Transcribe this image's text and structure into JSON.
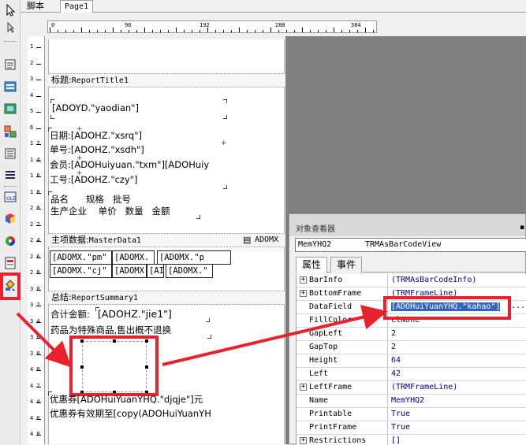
{
  "tabs": [
    {
      "label": "脚本"
    },
    {
      "label": "Page1"
    }
  ],
  "ruler": {
    "top_labels": [
      "0",
      "96",
      "192",
      "288",
      "384"
    ],
    "left_labels": [
      "1",
      "2",
      "3",
      "4",
      "5",
      "6",
      "1 2",
      "1 4",
      "1 6",
      "1 8",
      "2 0",
      "2 2",
      "2 4",
      "2 6",
      "2 8",
      "3 0",
      "3 2",
      "3 4",
      "3 6",
      "3 8",
      "4 0",
      "4 2",
      "4 4",
      "4 6",
      "4 8"
    ]
  },
  "bands": {
    "title": {
      "prefix": "标题:",
      "name": "ReportTitle1"
    },
    "master": {
      "prefix": "主项数据:",
      "name": "MasterData1",
      "dataset": "ADOMX"
    },
    "summary": {
      "prefix": "总结:",
      "name": "ReportSummary1"
    }
  },
  "report_title": {
    "shop": "[ADOYD.\"yaodian\"]",
    "lines": [
      "日期:[ADOHZ.\"xsrq\"]",
      "单号:[ADOHZ.\"xsdh\"]",
      "会员:[ADOHuiyuan.\"txm\"][ADOHuiy",
      "工号:[ADOHZ.\"czy\"]"
    ],
    "header_row1": "品名      规格   批号",
    "header_row2": "生产企业    单价   数量   金额"
  },
  "master_data": {
    "row1": [
      "[ADOMX.\"pm\"",
      "[ADOMX.",
      "[ADOMX.\"p"
    ],
    "row2": [
      "[ADOMX.\"cj\"",
      "[ADOMX",
      "[AI",
      "[ADOMX.\""
    ]
  },
  "summary": {
    "total_label": "合计金额:",
    "total_value": "[ADOHZ.\"jie1\"]",
    "notice": "药品为特殊商品,售出概不退换",
    "coupon1": "优惠券[ADOHuiYuanYHQ.\"djqje\"]元",
    "coupon2": "优惠券有效期至[copy(ADOHuiYuanYH"
  },
  "inspector": {
    "title": "对象查看器",
    "object_name": "MemYHQ2",
    "object_class": "TRMAsBarCodeView",
    "tabs": [
      {
        "label": "属性"
      },
      {
        "label": "事件"
      }
    ],
    "properties": [
      {
        "name": "BarInfo",
        "value": "(TRMAsBarCodeInfo)",
        "expandable": "+"
      },
      {
        "name": "BottomFrame",
        "value": "(TRMFrameLine)",
        "expandable": "+"
      },
      {
        "name": "DataField",
        "value": "[ADOHuiYuanYHQ.\"kahao\"]",
        "expandable": ""
      },
      {
        "name": "FillColor",
        "value": "clNone",
        "expandable": ""
      },
      {
        "name": "GapLeft",
        "value": "2",
        "expandable": ""
      },
      {
        "name": "GapTop",
        "value": "2",
        "expandable": ""
      },
      {
        "name": "Height",
        "value": "64",
        "expandable": ""
      },
      {
        "name": "Left",
        "value": "42",
        "expandable": ""
      },
      {
        "name": "LeftFrame",
        "value": "(TRMFrameLine)",
        "expandable": "+"
      },
      {
        "name": "Name",
        "value": "MemYHQ2",
        "expandable": ""
      },
      {
        "name": "Printable",
        "value": "True",
        "expandable": ""
      },
      {
        "name": "PrintFrame",
        "value": "True",
        "expandable": ""
      },
      {
        "name": "Restrictions",
        "value": "[]",
        "expandable": "+"
      }
    ],
    "ellipsis": "..."
  },
  "colors": {
    "annotation": "#e8222c",
    "selection": "#3163c5"
  }
}
